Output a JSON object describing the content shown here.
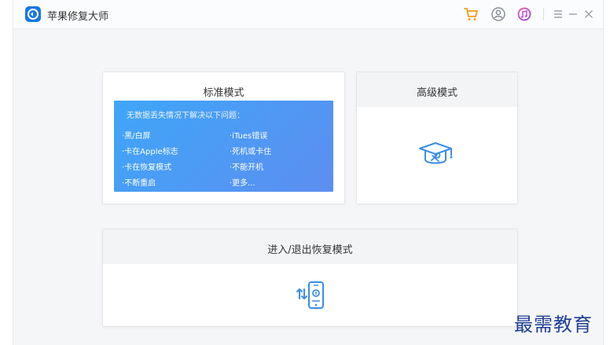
{
  "app": {
    "title": "苹果修复大师"
  },
  "toolbar": {
    "icons": [
      "cart-icon",
      "user-icon",
      "itunes-icon",
      "menu-icon",
      "minimize-icon",
      "close-icon"
    ],
    "accent_orange": "#f39c12",
    "accent_purple": "#c24bd2"
  },
  "modes": {
    "standard": {
      "title": "标准模式",
      "description": "无数据丢失情况下解决以下问题：",
      "items": [
        "·黑/白屏",
        "·iTues错误",
        "·卡在Apple标志",
        "·死机或卡住",
        "·卡在恢复模式",
        "·不能开机",
        "·不断重启",
        "·更多..."
      ]
    },
    "advanced": {
      "title": "高级模式"
    },
    "recovery": {
      "title": "进入/退出恢复模式"
    }
  },
  "watermark": "最需教育",
  "colors": {
    "primary_blue": "#3a8ee6",
    "box_gradient_start": "#3ea6f8",
    "box_gradient_end": "#5d8ef0"
  }
}
